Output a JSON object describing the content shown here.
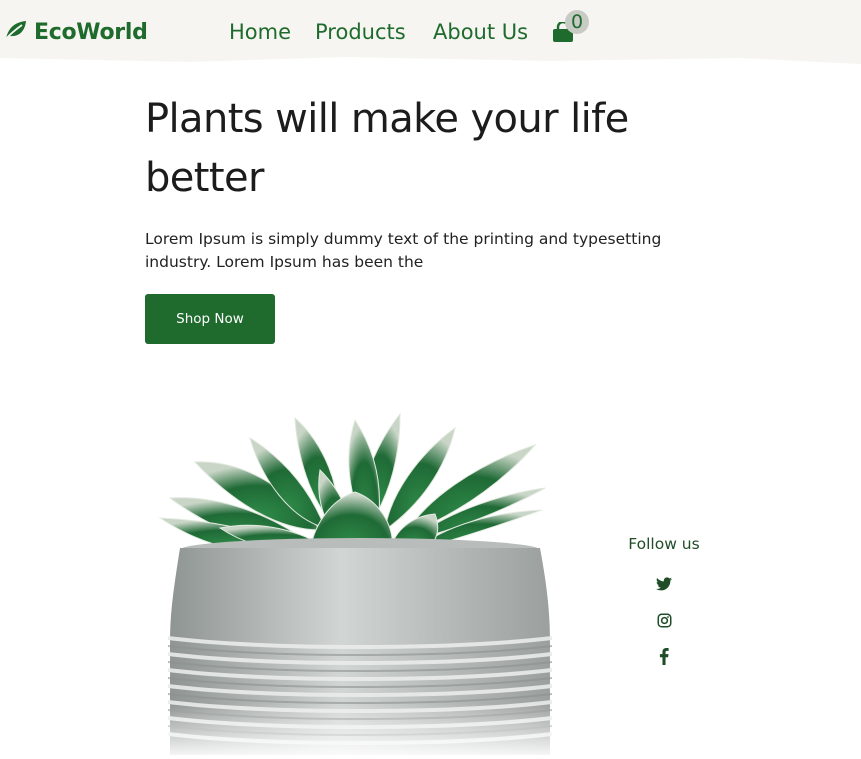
{
  "brand": {
    "name": "EcoWorld",
    "icon": "leaf-icon"
  },
  "nav": {
    "items": [
      {
        "label": "Home"
      },
      {
        "label": "Products"
      },
      {
        "label": "About Us"
      }
    ],
    "cart": {
      "icon": "shopping-bag-icon",
      "count": "0"
    }
  },
  "hero": {
    "title": "Plants will make your life better",
    "description": "Lorem Ipsum is simply dummy text of the printing and typesetting industry. Lorem Ipsum has been the",
    "cta_label": "Shop Now"
  },
  "social": {
    "label": "Follow us",
    "icons": [
      "twitter-icon",
      "instagram-icon",
      "facebook-icon"
    ]
  },
  "colors": {
    "brand_green": "#1e6b2d",
    "header_bg": "#f6f5f1",
    "badge_bg": "#c7cbc4",
    "text_dark": "#1c1c1c"
  }
}
